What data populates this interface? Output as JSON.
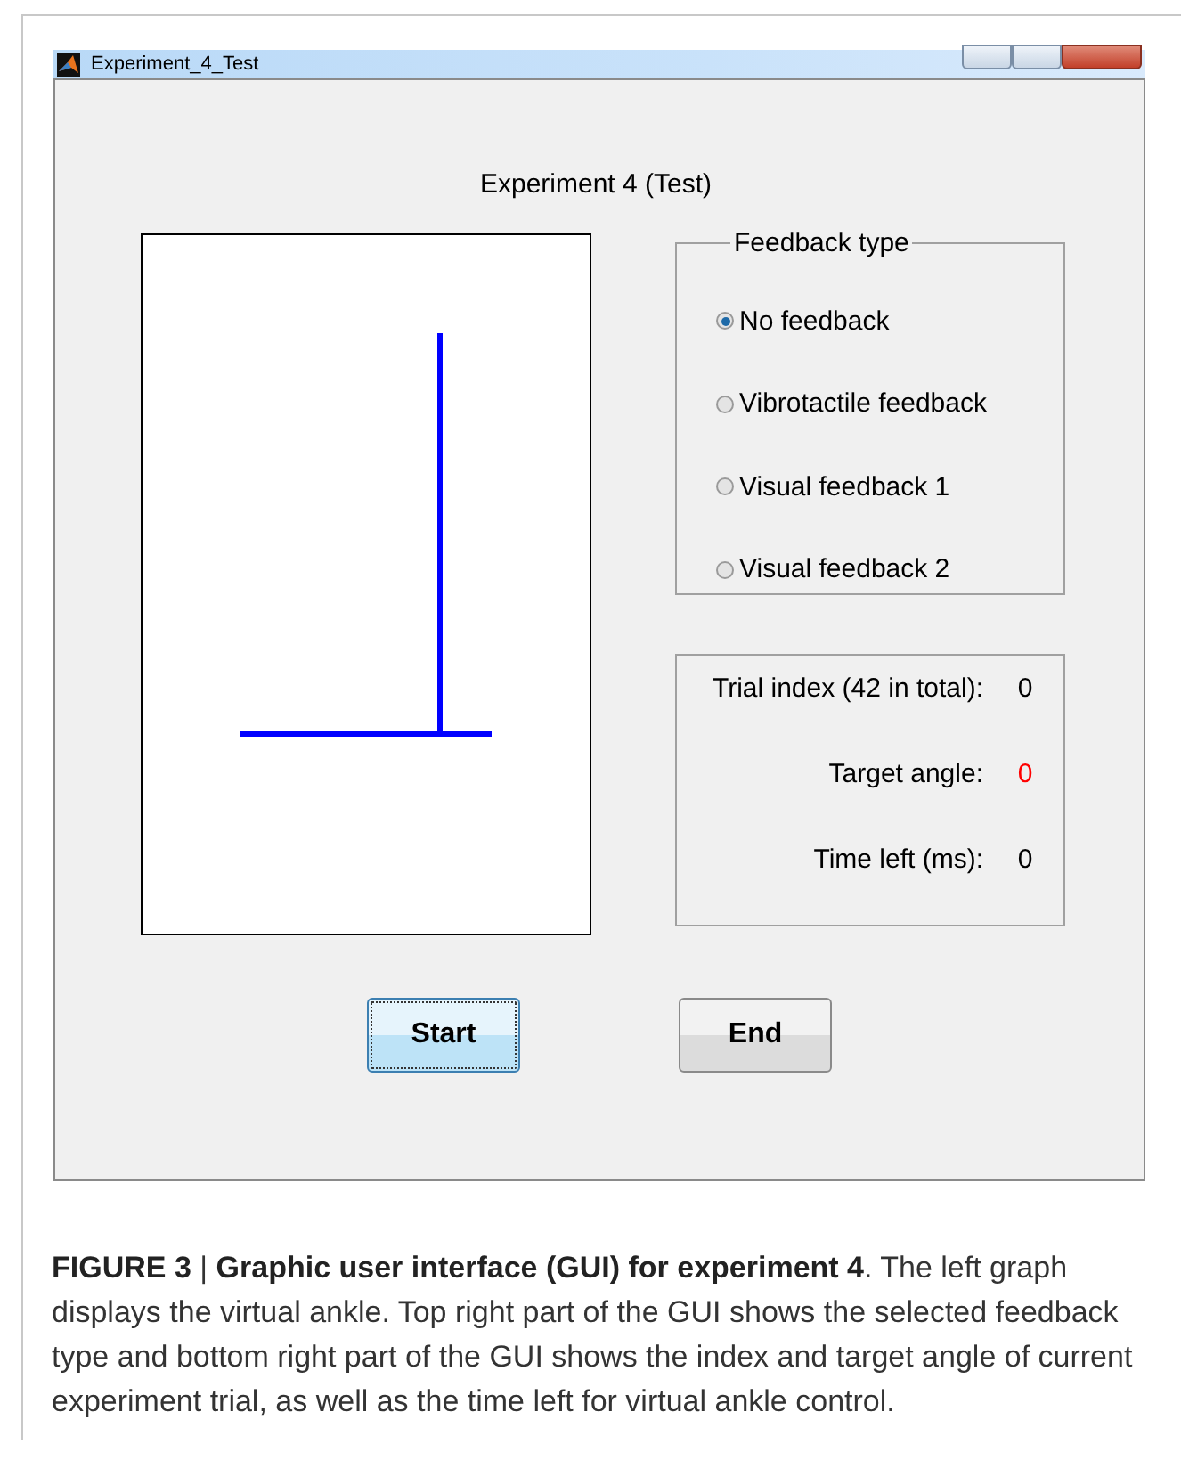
{
  "window": {
    "title": "Experiment_4_Test",
    "heading": "Experiment 4 (Test)"
  },
  "feedback_type": {
    "title": "Feedback type",
    "options": [
      {
        "label": "No feedback",
        "selected": true
      },
      {
        "label": "Vibrotactile feedback",
        "selected": false
      },
      {
        "label": "Visual feedback 1",
        "selected": false
      },
      {
        "label": "Visual feedback 2",
        "selected": false
      }
    ]
  },
  "info": [
    {
      "label": "Trial index (42 in total):",
      "value": "0",
      "color": "#000000"
    },
    {
      "label": "Target angle:",
      "value": "0",
      "color": "#ff0000"
    },
    {
      "label": "Time left (ms):",
      "value": "0",
      "color": "#000000"
    }
  ],
  "buttons": [
    {
      "label": "Start",
      "focused": true
    },
    {
      "label": "End",
      "focused": false
    }
  ],
  "caption": "**FIGURE 3** | **Graphic user interface (GUI) for experiment 4**. The left graph displays the virtual ankle. Top right part of the GUI shows the selected feedback type and bottom right part of the GUI shows the index and target angle of current experiment trial, as well as the time left for virtual ankle control."
}
